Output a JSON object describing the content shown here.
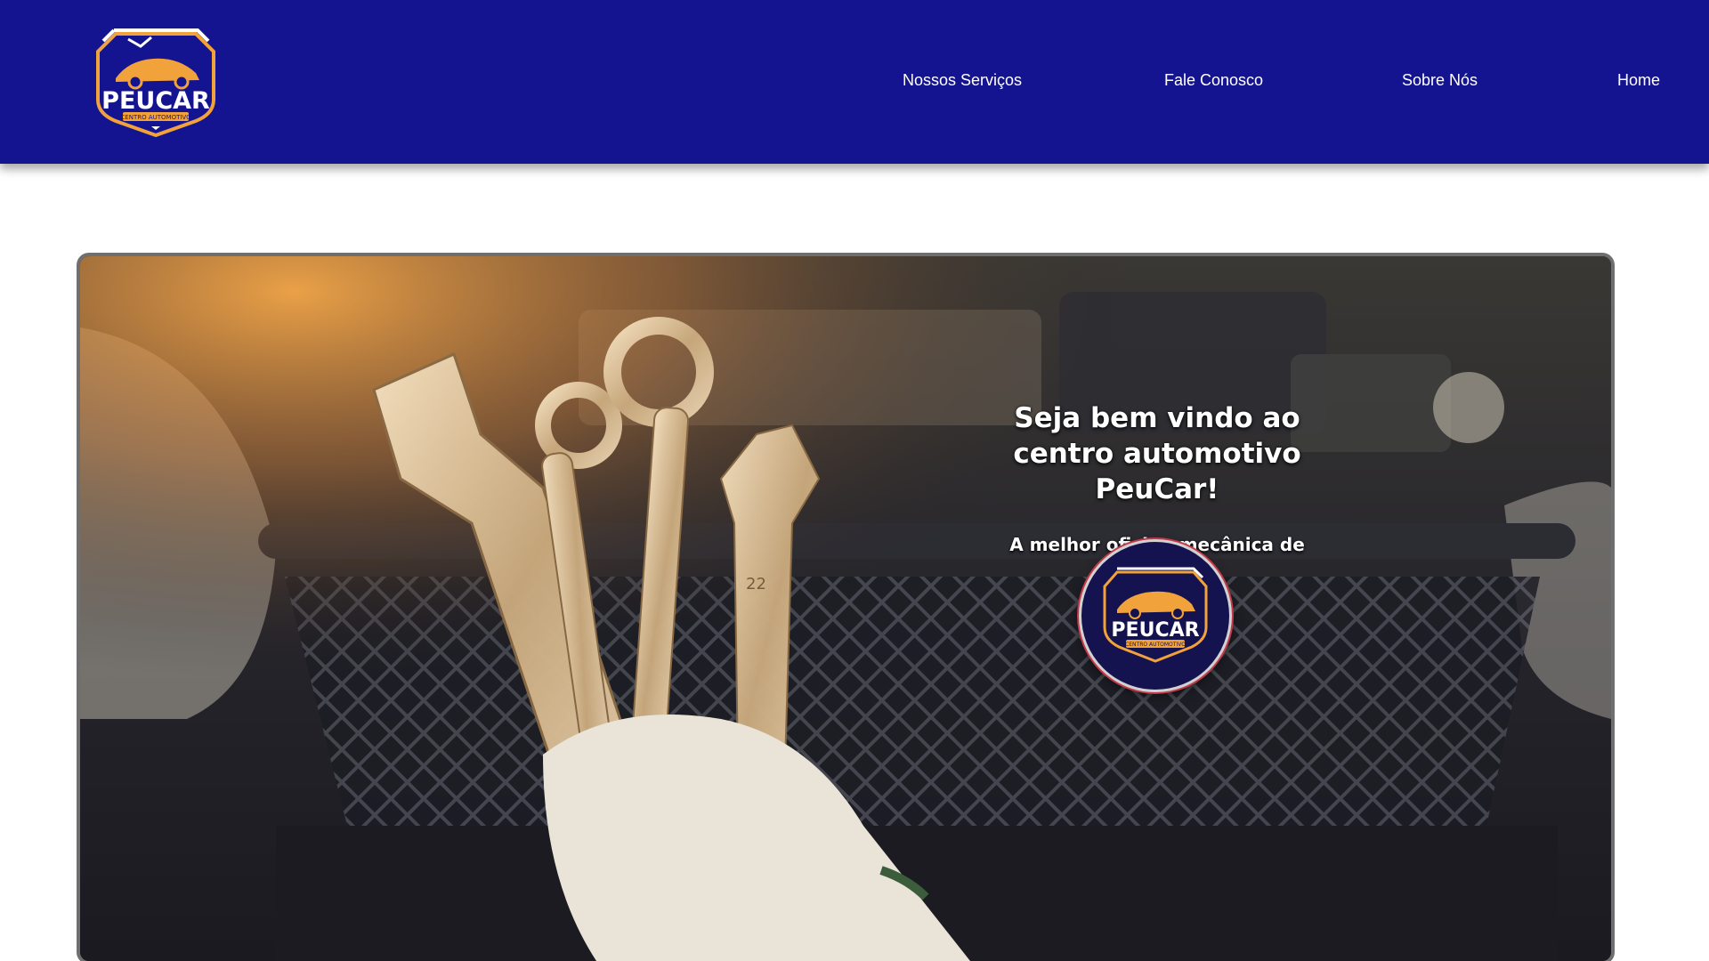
{
  "brand": {
    "name": "PEUCAR",
    "tagline": "CENTRO AUTOMOTIVO",
    "colors": {
      "header": "#141490",
      "accent": "#f2a23a",
      "badge": "#14124f"
    }
  },
  "nav": {
    "items": [
      {
        "label": "Nossos Serviços"
      },
      {
        "label": "Fale Conosco"
      },
      {
        "label": "Sobre Nós"
      },
      {
        "label": "Home"
      }
    ]
  },
  "hero": {
    "title": "Seja bem vindo ao centro automotivo PeuCar!",
    "subtitle": "A melhor oficina mecânica de Ipirá!",
    "image": "mechanic-hand-holding-wrenches-in-front-of-car-engine",
    "wrench_mark": "22"
  }
}
